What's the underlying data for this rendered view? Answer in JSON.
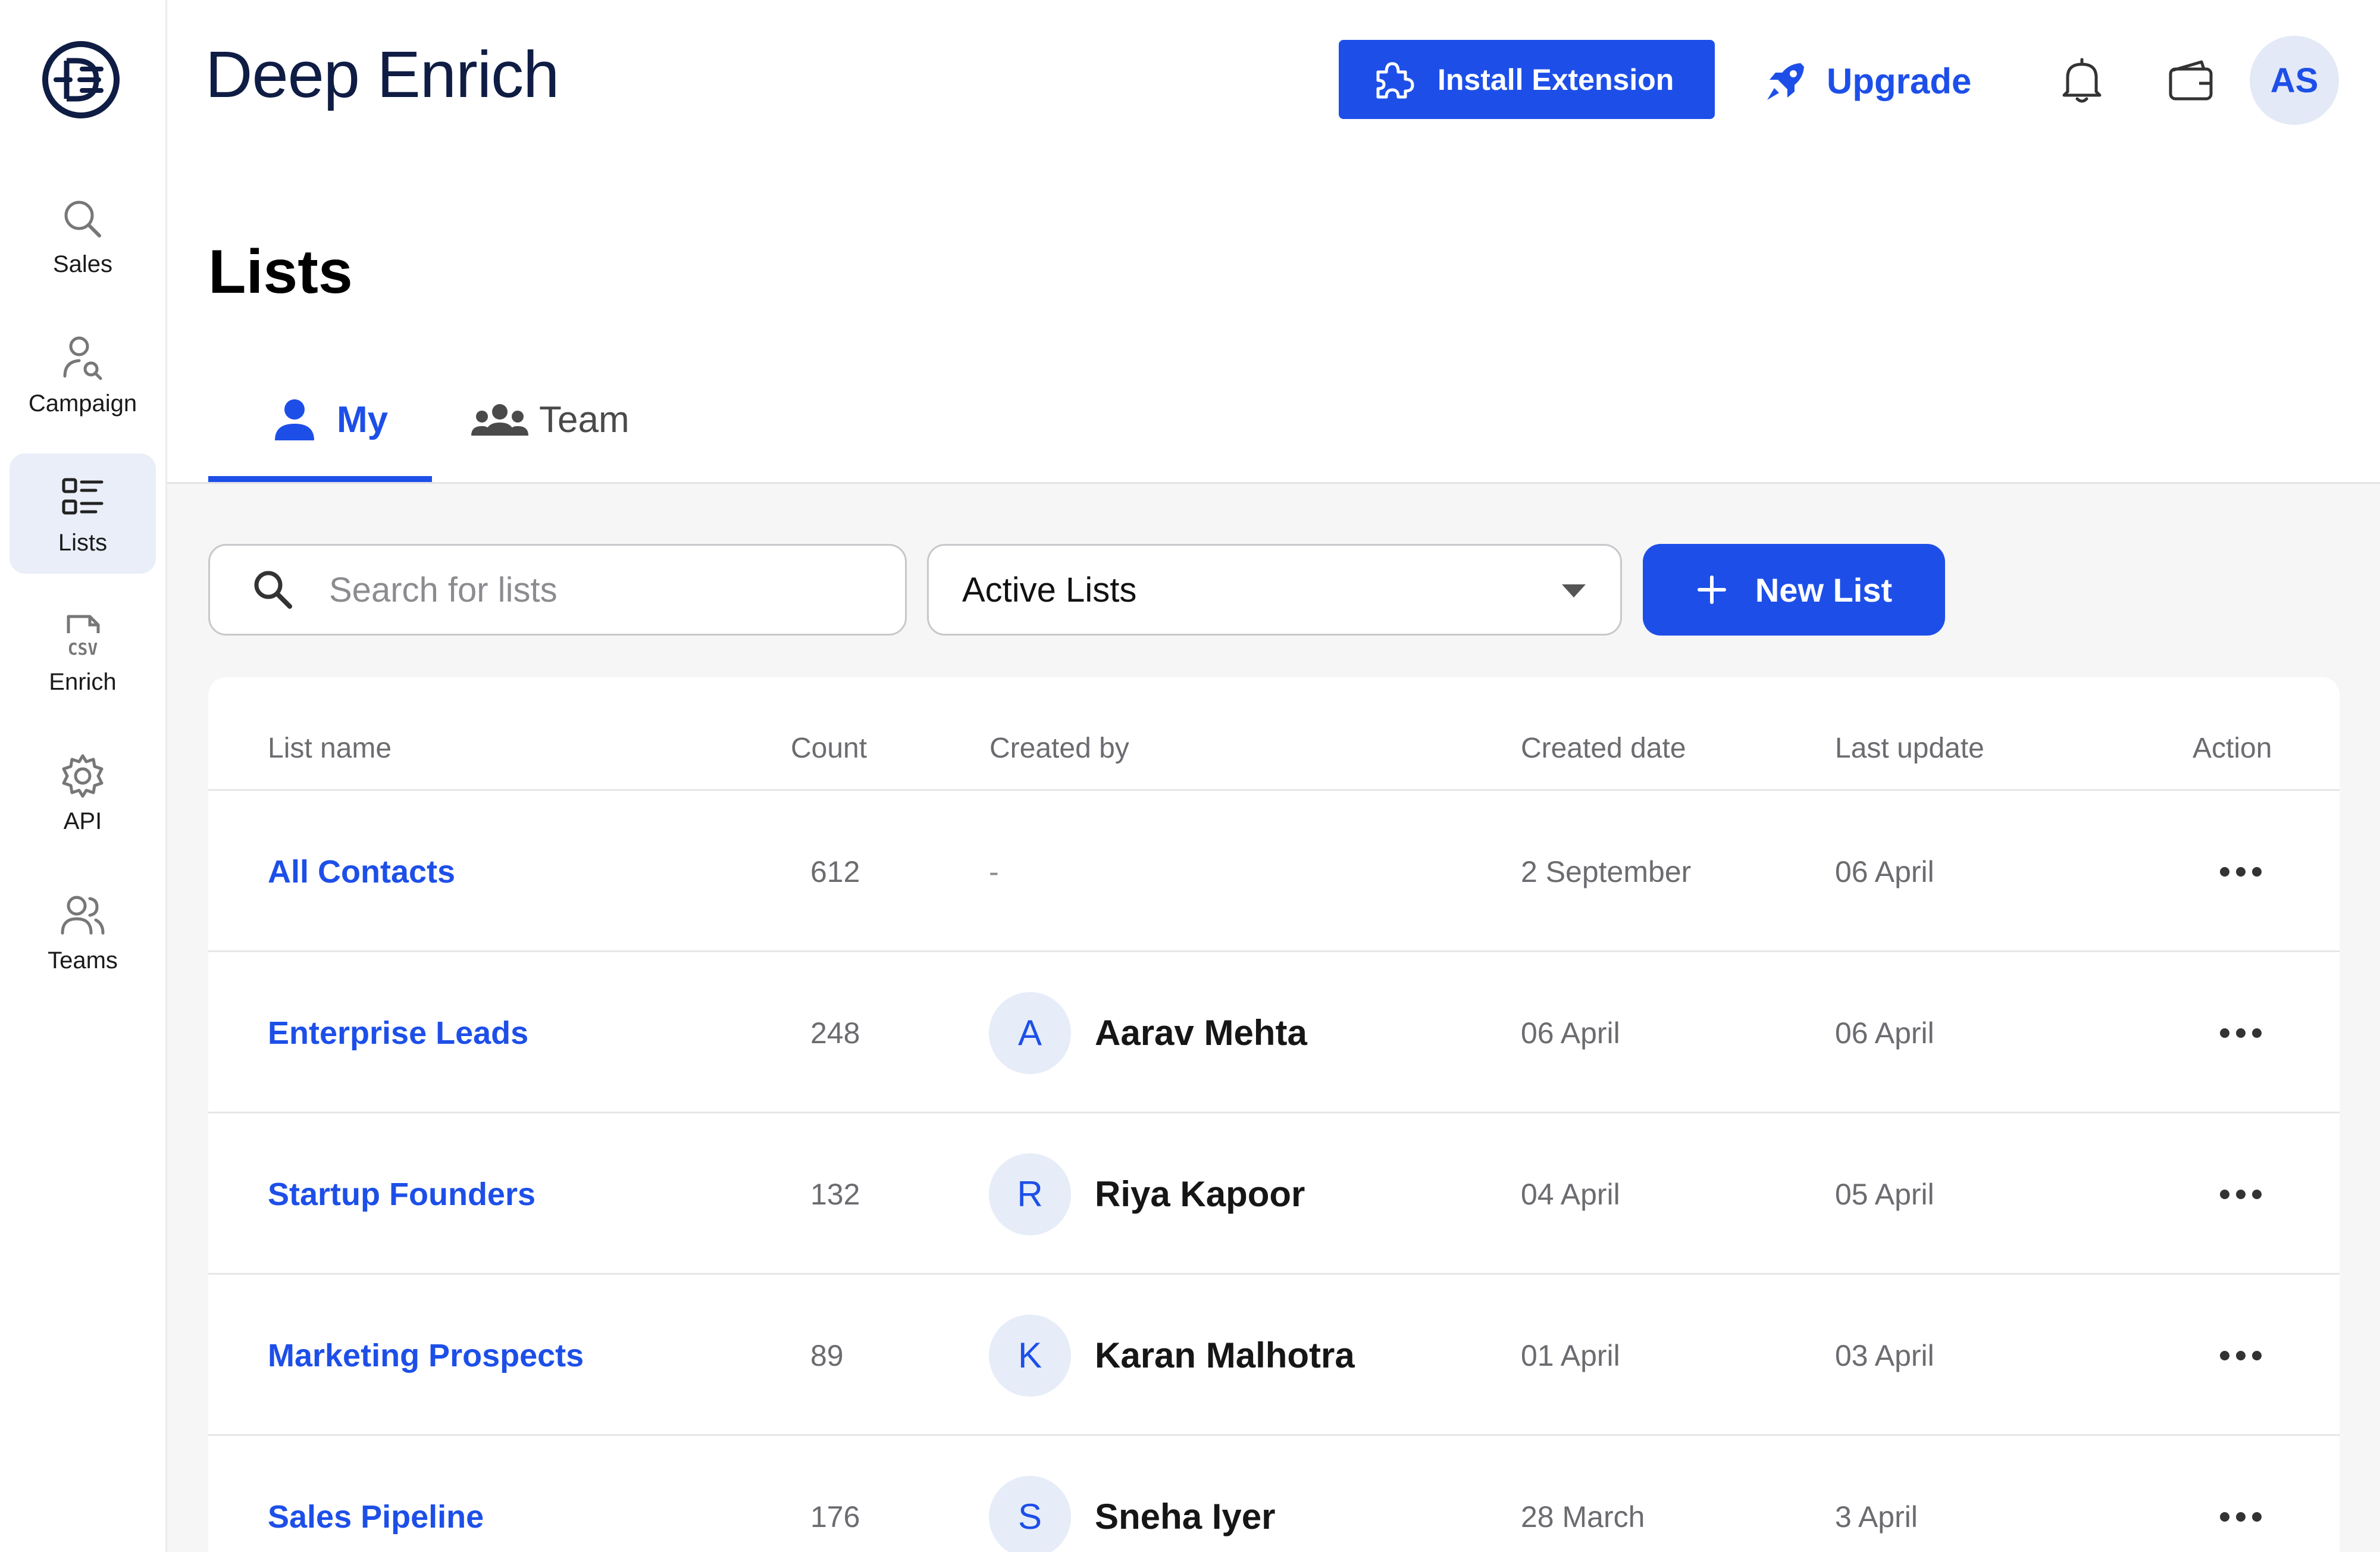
{
  "app": {
    "brand": "Deep Enrich"
  },
  "colors": {
    "accent": "#1d4fe8",
    "brand_dark": "#0f1d44",
    "sidebar_active": "#e9eef8"
  },
  "sidebar": {
    "items": [
      {
        "label": "Sales",
        "icon": "search-icon",
        "active": false
      },
      {
        "label": "Campaign",
        "icon": "person-search-icon",
        "active": false
      },
      {
        "label": "Lists",
        "icon": "list-icon",
        "active": true
      },
      {
        "label": "Enrich",
        "icon": "csv-file-icon",
        "active": false
      },
      {
        "label": "API",
        "icon": "gear-icon",
        "active": false
      },
      {
        "label": "Teams",
        "icon": "people-icon",
        "active": false
      }
    ]
  },
  "header": {
    "install_label": "Install Extension",
    "upgrade_label": "Upgrade",
    "avatar_initials": "AS"
  },
  "page": {
    "title": "Lists",
    "tabs": [
      {
        "label": "My",
        "active": true
      },
      {
        "label": "Team",
        "active": false
      }
    ],
    "search": {
      "placeholder": "Search for lists"
    },
    "filter": {
      "selected": "Active Lists"
    },
    "new_list_label": "New List"
  },
  "table": {
    "columns": [
      "List name",
      "Count",
      "Created by",
      "Created date",
      "Last update",
      "Action"
    ],
    "rows": [
      {
        "name": "All Contacts",
        "count": "612",
        "initial": "",
        "created_by": "-",
        "created_date": "2 September",
        "last_update": "06 April"
      },
      {
        "name": "Enterprise Leads",
        "count": "248",
        "initial": "A",
        "created_by": "Aarav Mehta",
        "created_date": "06 April",
        "last_update": "06 April"
      },
      {
        "name": "Startup Founders",
        "count": "132",
        "initial": "R",
        "created_by": "Riya Kapoor",
        "created_date": "04 April",
        "last_update": "05 April"
      },
      {
        "name": "Marketing Prospects",
        "count": "89",
        "initial": "K",
        "created_by": "Karan Malhotra",
        "created_date": "01 April",
        "last_update": "03 April"
      },
      {
        "name": "Sales Pipeline",
        "count": "176",
        "initial": "S",
        "created_by": "Sneha Iyer",
        "created_date": "28 March",
        "last_update": "3 April"
      }
    ]
  }
}
